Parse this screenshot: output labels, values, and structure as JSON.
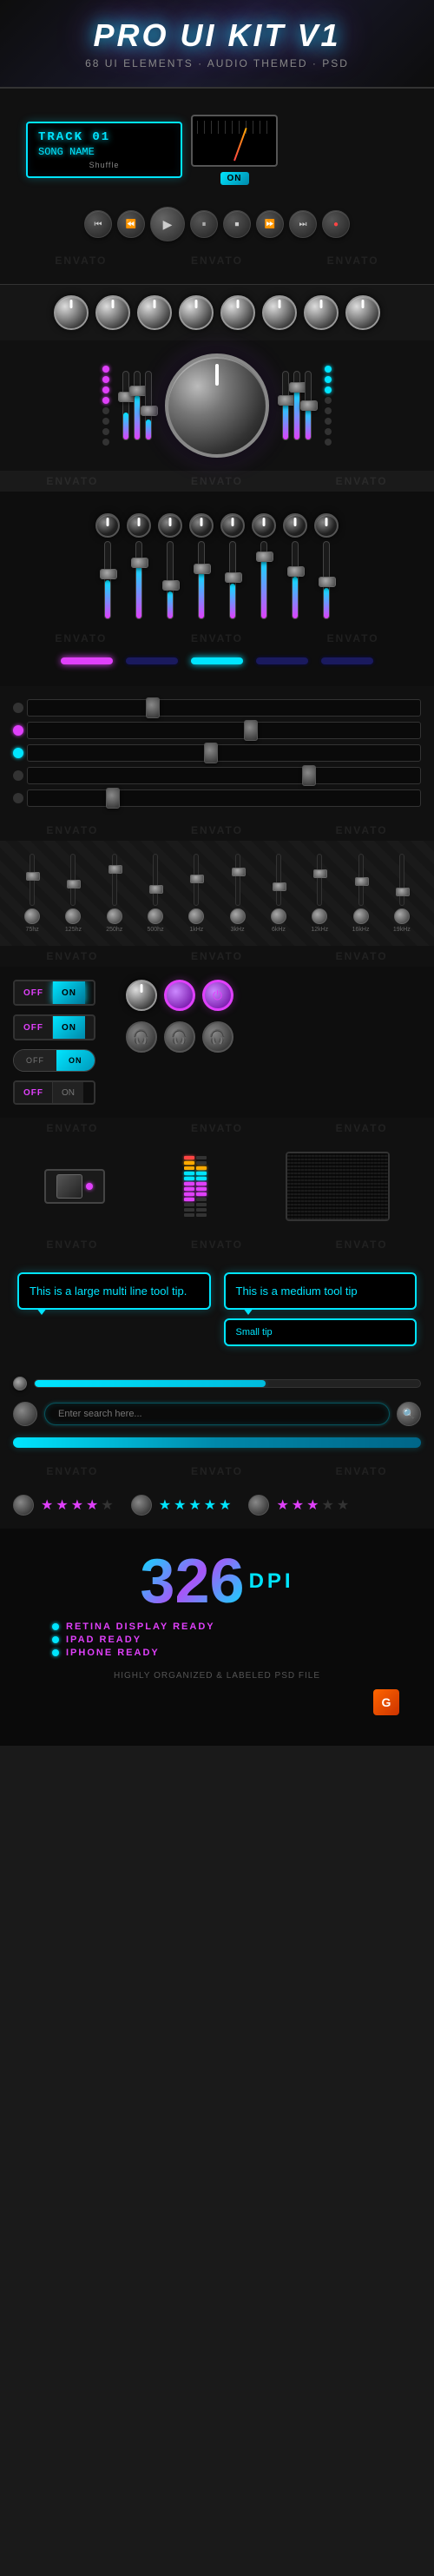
{
  "header": {
    "title": "PRO UI KIT V1",
    "subtitle": "68 UI ELEMENTS  ·  AUDIO THEMED  ·  PSD"
  },
  "track": {
    "name": "TRACK 01",
    "song": "SONG NAME",
    "shuffle": "Shuffle",
    "on_badge": "ON"
  },
  "transport": {
    "buttons": [
      "⏮",
      "⏪",
      "▶",
      "⏸",
      "⏹",
      "⏩",
      "⏭",
      "●"
    ]
  },
  "eq_labels": [
    "75hz",
    "125hz",
    "250hz",
    "500hz",
    "1kHz",
    "3kHz",
    "6kHz",
    "12kHz",
    "16kHz",
    "19kHz"
  ],
  "toggles": {
    "off_label": "OFF",
    "on_label": "ON"
  },
  "tooltip": {
    "large": "This is a large multi line tool tip.",
    "medium": "This is a medium tool tip",
    "small": "Small tip"
  },
  "dpi": {
    "number": "326",
    "unit": "DPI",
    "features": [
      "RETINA DISPLAY READY",
      "IPAD READY",
      "IPHONE READY"
    ],
    "psd_note": "HIGHLY ORGANIZED & LABELED PSD FILE"
  },
  "search": {
    "placeholder": "Enter search here..."
  },
  "stars": {
    "pink_count": 4,
    "total": 5
  }
}
